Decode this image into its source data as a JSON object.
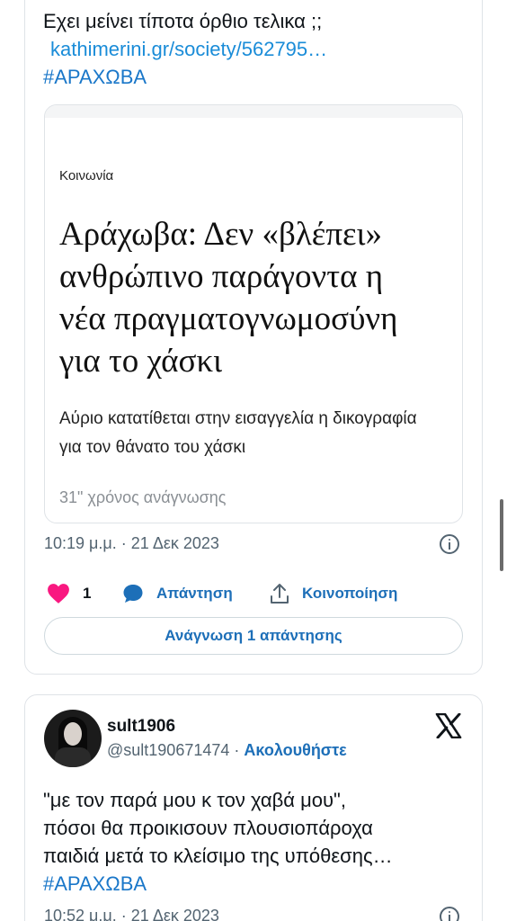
{
  "tweet1": {
    "text_line1": "Εχει μείνει τίποτα όρθιο τελικα ;;",
    "link": "kathimerini.gr/society/562795…",
    "hashtag": "#ΑΡΑΧΩΒΑ",
    "card": {
      "section": "Κοινωνία",
      "headline": [
        "Αράχωβα: Δεν «βλέπει»",
        "ανθρώπινο παράγοντα η",
        "νέα πραγματογνωμοσύνη",
        "για το χάσκι"
      ],
      "summary": [
        "Αύριο κατατίθεται στην εισαγγελία η δικογραφία",
        "για τον θάνατο του χάσκι"
      ],
      "read_time": "31\" χρόνος ανάγνωσης"
    },
    "timestamp": "10:19 μ.μ. · 21 Δεκ 2023",
    "like_count": "1",
    "reply_label": "Απάντηση",
    "share_label": "Κοινοποίηση",
    "read_replies_label": "Ανάγνωση 1 απάντησης"
  },
  "tweet2": {
    "username": "sult1906",
    "handle": "@sult190671474",
    "separator": " · ",
    "follow_label": "Ακολουθήστε",
    "text_lines": [
      "\"με τον παρά μου κ τον χαβά μου\",",
      "πόσοι θα προικισουν πλουσιοπάροχα",
      "παιδιά μετά το κλείσιμο της υπόθεσης…"
    ],
    "hashtag": "#ΑΡΑΧΩΒΑ",
    "timestamp": "10:52 μ.μ. · 21 Δεκ 2023"
  },
  "colors": {
    "accent": "#1d6fb8",
    "like": "#f91880",
    "text": "#0f1419",
    "muted": "#536471"
  },
  "icons": {
    "like": "heart-icon",
    "reply": "reply-bubble-icon",
    "share": "share-icon",
    "info": "info-icon",
    "brand": "x-logo-icon"
  }
}
